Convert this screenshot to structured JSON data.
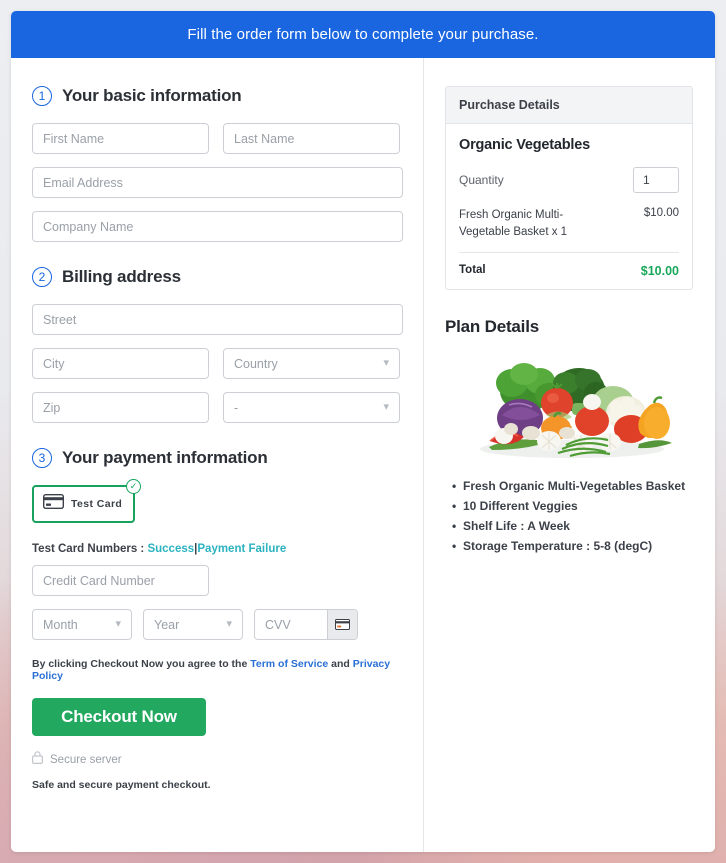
{
  "banner": {
    "text": "Fill the order form below to complete your purchase."
  },
  "sections": {
    "basic": {
      "number": "1",
      "title": "Your basic information",
      "fields": {
        "first_name": "First Name",
        "last_name": "Last Name",
        "email": "Email Address",
        "company": "Company Name"
      }
    },
    "billing": {
      "number": "2",
      "title": "Billing address",
      "fields": {
        "street": "Street",
        "city": "City",
        "country": "Country",
        "zip": "Zip",
        "state": "-"
      }
    },
    "payment": {
      "number": "3",
      "title": "Your payment information",
      "method_label": "Test  Card",
      "card_icon": "credit-card-icon",
      "selected_badge": "check-icon",
      "testcards_label": "Test Card Numbers :",
      "testcards_success": "Success",
      "testcards_separator": "|",
      "testcards_failure": "Payment Failure",
      "fields": {
        "card_number": "Credit Card Number",
        "month": "Month",
        "year": "Year",
        "cvv": "CVV"
      },
      "cvv_icon": "credit-card-icon"
    }
  },
  "footer": {
    "terms_prefix": "By clicking Checkout Now you agree to the",
    "terms_link": "Term of Service",
    "terms_and": "and",
    "privacy_link": "Privacy Policy",
    "checkout_label": "Checkout Now",
    "secure_icon": "lock-icon",
    "secure_text": "Secure server",
    "safe_text": "Safe and secure payment checkout."
  },
  "purchase_details": {
    "header": "Purchase Details",
    "product": "Organic Vegetables",
    "quantity_label": "Quantity",
    "quantity_value": "1",
    "item_name": "Fresh Organic Multi-Vegetable Basket x 1",
    "item_price": "$10.00",
    "total_label": "Total",
    "total_value": "$10.00",
    "total_color": "#19a85b"
  },
  "plan_details": {
    "title": "Plan Details",
    "image": "organic-vegetables-photo",
    "bullets": [
      "Fresh Organic Multi-Vegetables Basket",
      "10 Different Veggies",
      "Shelf Life : A Week",
      "Storage Temperature : 5-8 (degC)"
    ]
  },
  "colors": {
    "banner_blue": "#1a66e0",
    "checkout_green": "#23a860",
    "selected_green": "#17a35c",
    "link_teal": "#2bb3c0",
    "link_blue": "#2a6fd6"
  }
}
